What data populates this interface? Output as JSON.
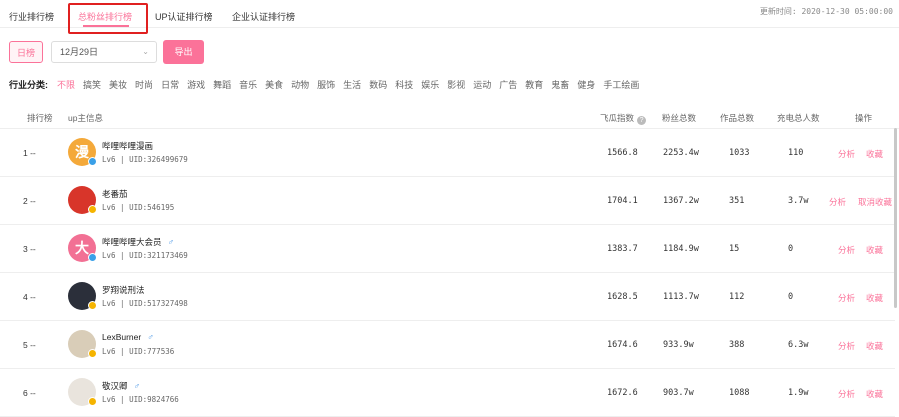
{
  "tabs": [
    {
      "label": "行业排行榜",
      "active": false
    },
    {
      "label": "总粉丝排行榜",
      "active": true
    },
    {
      "label": "UP认证排行榜",
      "active": false
    },
    {
      "label": "企业认证排行榜",
      "active": false
    }
  ],
  "update_time": "更新时间: 2020-12-30 05:00:00",
  "controls": {
    "daily_label": "日榜",
    "date_value": "12月29日",
    "export_label": "导出"
  },
  "categories": {
    "label": "行业分类:",
    "items": [
      "不限",
      "搞笑",
      "美妆",
      "时尚",
      "日常",
      "游戏",
      "舞蹈",
      "音乐",
      "美食",
      "动物",
      "服饰",
      "生活",
      "数码",
      "科技",
      "娱乐",
      "影视",
      "运动",
      "广告",
      "教育",
      "鬼畜",
      "健身",
      "手工绘画"
    ]
  },
  "table": {
    "headers": {
      "rank": "排行榜",
      "up_info": "up主信息",
      "feigua": "飞瓜指数",
      "fans": "粉丝总数",
      "works": "作品总数",
      "charge": "充电总人数",
      "ops": "操作"
    },
    "rows": [
      {
        "rank": "1 --",
        "name": "哔哩哔哩漫画",
        "gender": "",
        "meta": "Lv6 | UID:326499679",
        "feigua": "1566.8",
        "fans": "2253.4w",
        "works": "1033",
        "charge": "110",
        "op1": "分析",
        "op2": "收藏",
        "avatar_color": "#f4a93a",
        "avatar_glyph": "漫"
      },
      {
        "rank": "2 --",
        "name": "老番茄",
        "gender": "",
        "meta": "Lv6 | UID:546195",
        "feigua": "1704.1",
        "fans": "1367.2w",
        "works": "351",
        "charge": "3.7w",
        "op1": "分析",
        "op2": "取消收藏",
        "avatar_color": "#d8352a",
        "avatar_glyph": ""
      },
      {
        "rank": "3 --",
        "name": "哔哩哔哩大会员",
        "gender": "♂",
        "meta": "Lv6 | UID:321173469",
        "feigua": "1383.7",
        "fans": "1184.9w",
        "works": "15",
        "charge": "0",
        "op1": "分析",
        "op2": "收藏",
        "avatar_color": "#f27094",
        "avatar_glyph": "大"
      },
      {
        "rank": "4 --",
        "name": "罗翔说刑法",
        "gender": "",
        "meta": "Lv6 | UID:517327498",
        "feigua": "1628.5",
        "fans": "1113.7w",
        "works": "112",
        "charge": "0",
        "op1": "分析",
        "op2": "收藏",
        "avatar_color": "#2b2f3a",
        "avatar_glyph": ""
      },
      {
        "rank": "5 --",
        "name": "LexBurner",
        "gender": "♂",
        "meta": "Lv6 | UID:777536",
        "feigua": "1674.6",
        "fans": "933.9w",
        "works": "388",
        "charge": "6.3w",
        "op1": "分析",
        "op2": "收藏",
        "avatar_color": "#d9cdb8",
        "avatar_glyph": ""
      },
      {
        "rank": "6 --",
        "name": "敬汉卿",
        "gender": "♂",
        "meta": "Lv6 | UID:9824766",
        "feigua": "1672.6",
        "fans": "903.7w",
        "works": "1088",
        "charge": "1.9w",
        "op1": "分析",
        "op2": "收藏",
        "avatar_color": "#e9e4dd",
        "avatar_glyph": ""
      }
    ]
  },
  "colors": {
    "accent": "#fb7299",
    "highlight_box": "#e02020",
    "badge_yellow": "#f5b400",
    "badge_blue": "#3aa0e8"
  }
}
